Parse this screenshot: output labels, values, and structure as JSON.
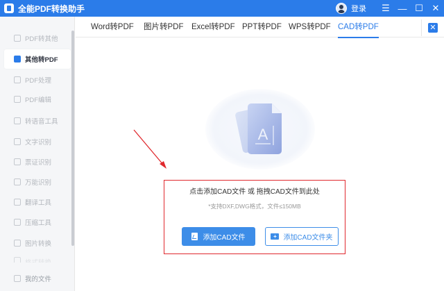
{
  "app": {
    "title": "全能PDF转换助手",
    "login_label": "登录"
  },
  "window_controls": {
    "menu": "☰",
    "minimize": "—",
    "maximize": "☐",
    "close": "✕"
  },
  "sidebar": {
    "items": [
      {
        "label": "PDF转其他",
        "state": "normal"
      },
      {
        "label": "其他转PDF",
        "state": "active"
      },
      {
        "label": "PDF处理",
        "state": "normal"
      },
      {
        "label": "PDF编辑",
        "state": "normal"
      },
      {
        "label": "转语音工具",
        "state": "normal"
      },
      {
        "label": "文字识别",
        "state": "normal"
      },
      {
        "label": "票证识别",
        "state": "normal"
      },
      {
        "label": "万能识别",
        "state": "normal"
      },
      {
        "label": "翻译工具",
        "state": "normal"
      },
      {
        "label": "压缩工具",
        "state": "normal"
      },
      {
        "label": "图片转换",
        "state": "normal"
      },
      {
        "label": "格式转换",
        "state": "faded"
      }
    ],
    "bottom_item": {
      "label": "我的文件"
    }
  },
  "tabs": [
    {
      "label": "Word转PDF",
      "active": false
    },
    {
      "label": "图片转PDF",
      "active": false
    },
    {
      "label": "Excel转PDF",
      "active": false
    },
    {
      "label": "PPT转PDF",
      "active": false
    },
    {
      "label": "WPS转PDF",
      "active": false
    },
    {
      "label": "CAD转PDF",
      "active": true
    }
  ],
  "tab_close": "✕",
  "upload": {
    "title": "点击添加CAD文件 或 拖拽CAD文件到此处",
    "subtitle": "*支持DXF,DWG格式，文件≤150MB",
    "add_file_button": "添加CAD文件",
    "add_folder_button": "添加CAD文件夹",
    "illustration_letter": "A"
  },
  "colors": {
    "accent": "#2b7ce9",
    "highlight_box": "#e0282d",
    "button": "#3d8de8"
  }
}
